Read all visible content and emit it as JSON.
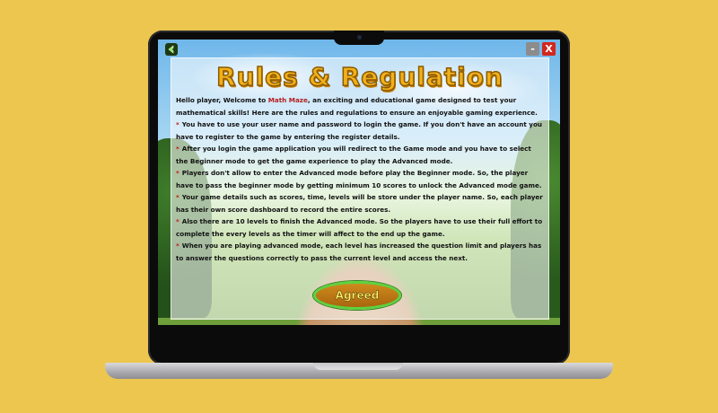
{
  "window": {
    "minimize_label": "-",
    "close_label": "X"
  },
  "rules": {
    "title": "Rules & Regulation",
    "intro_before": "Hello player, Welcome to ",
    "app_name": "Math Maze",
    "intro_after": ", an exciting and educational game designed to test your mathematical skills! Here are the rules and regulations to ensure an enjoyable gaming experience.",
    "bullet_symbol": "*",
    "items": [
      "You have to use your user name and password to login the game. If you don't have an account you have to register to the game by entering the register details.",
      "After you login the game application you will redirect to the Game mode and you have to select the Beginner mode to get the game experience to play the Advanced mode.",
      "Players don't allow to enter the Advanced mode before play the Beginner mode. So, the player have to pass the beginner mode by getting minimum 10 scores to unlock the Advanced mode game.",
      "Your game details such as scores, time, levels will be store under the player name. So, each player has their own score dashboard to record the entire  scores.",
      "Also there are 10 levels to finish the Advanced mode. So the players have to use their full effort to complete the every levels as the timer will affect to the end up the game.",
      "When you are playing advanced mode, each level has increased the question limit and players has to answer the questions correctly to pass the current level and access the next."
    ]
  },
  "actions": {
    "agreed_label": "Agreed"
  },
  "icons": {
    "back": "back-arrow-icon",
    "minimize": "minimize-icon",
    "close": "close-icon"
  },
  "colors": {
    "background": "#ecc64f",
    "title": "#f2b01a",
    "brand": "#b51d1d",
    "bullet": "#c21a1a",
    "button_fill": "#b8741a",
    "button_border": "#5fd13f"
  }
}
